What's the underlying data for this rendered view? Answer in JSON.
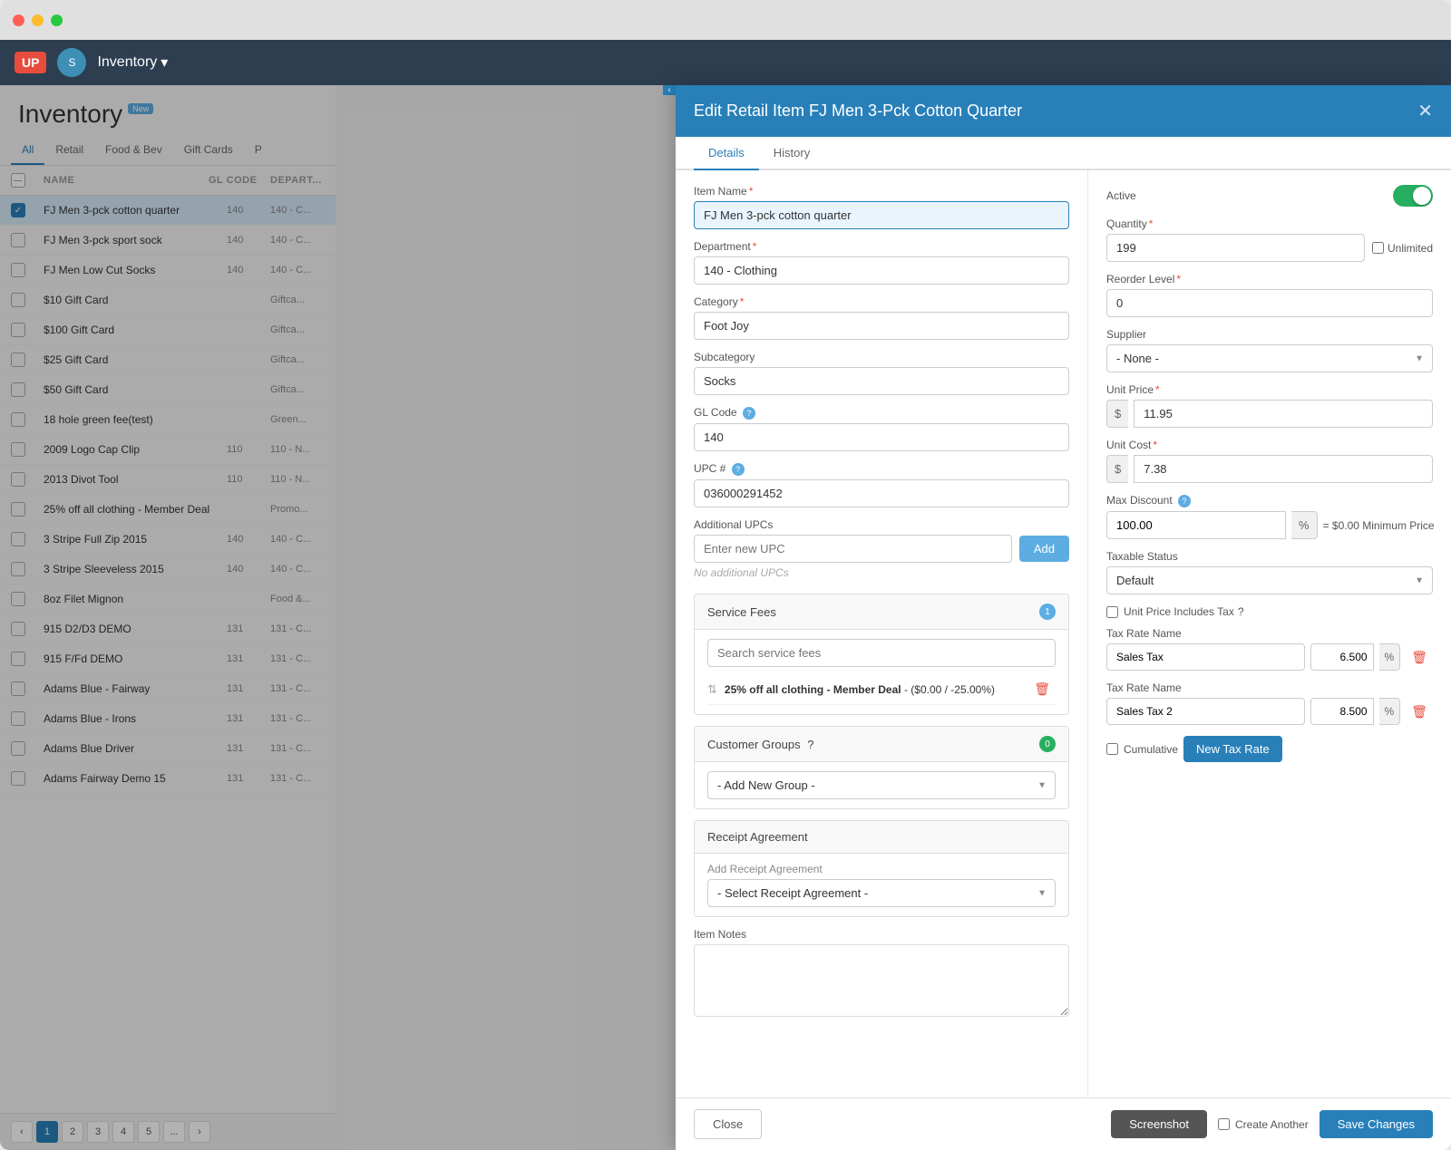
{
  "app": {
    "title": "Inventory",
    "title_badge": "New",
    "nav": {
      "logo_up": "UP",
      "logo_icon": "S",
      "title": "Inventory",
      "caret": "▾"
    }
  },
  "filter_tabs": [
    {
      "label": "All",
      "active": true
    },
    {
      "label": "Retail",
      "active": false
    },
    {
      "label": "Food & Bev",
      "active": false
    },
    {
      "label": "Gift Cards",
      "active": false
    },
    {
      "label": "P",
      "active": false
    }
  ],
  "table_headers": {
    "name": "NAME",
    "gl": "GL CODE",
    "dept": "DEPART..."
  },
  "inventory_items": [
    {
      "selected": true,
      "name": "FJ Men 3-pck cotton quarter",
      "gl": "140",
      "dept": "140 - C..."
    },
    {
      "selected": false,
      "name": "FJ Men 3-pck sport sock",
      "gl": "140",
      "dept": "140 - C..."
    },
    {
      "selected": false,
      "name": "FJ Men Low Cut Socks",
      "gl": "140",
      "dept": "140 - C..."
    },
    {
      "selected": false,
      "name": "$10 Gift Card",
      "gl": "",
      "dept": "Giftca..."
    },
    {
      "selected": false,
      "name": "$100 Gift Card",
      "gl": "",
      "dept": "Giftca..."
    },
    {
      "selected": false,
      "name": "$25 Gift Card",
      "gl": "",
      "dept": "Giftca..."
    },
    {
      "selected": false,
      "name": "$50 Gift Card",
      "gl": "",
      "dept": "Giftca..."
    },
    {
      "selected": false,
      "name": "18 hole green fee(test)",
      "gl": "",
      "dept": "Green..."
    },
    {
      "selected": false,
      "name": "2009 Logo Cap Clip",
      "gl": "110",
      "dept": "110 - N..."
    },
    {
      "selected": false,
      "name": "2013 Divot Tool",
      "gl": "110",
      "dept": "110 - N..."
    },
    {
      "selected": false,
      "name": "25% off all clothing - Member Deal",
      "gl": "",
      "dept": "Promo..."
    },
    {
      "selected": false,
      "name": "3 Stripe Full Zip 2015",
      "gl": "140",
      "dept": "140 - C..."
    },
    {
      "selected": false,
      "name": "3 Stripe Sleeveless 2015",
      "gl": "140",
      "dept": "140 - C..."
    },
    {
      "selected": false,
      "name": "8oz Filet Mignon",
      "gl": "",
      "dept": "Food &..."
    },
    {
      "selected": false,
      "name": "915 D2/D3 DEMO",
      "gl": "131",
      "dept": "131 - C..."
    },
    {
      "selected": false,
      "name": "915 F/Fd DEMO",
      "gl": "131",
      "dept": "131 - C..."
    },
    {
      "selected": false,
      "name": "Adams Blue - Fairway",
      "gl": "131",
      "dept": "131 - C..."
    },
    {
      "selected": false,
      "name": "Adams Blue - Irons",
      "gl": "131",
      "dept": "131 - C..."
    },
    {
      "selected": false,
      "name": "Adams Blue Driver",
      "gl": "131",
      "dept": "131 - C..."
    },
    {
      "selected": false,
      "name": "Adams Fairway Demo 15",
      "gl": "131",
      "dept": "131 - C..."
    }
  ],
  "pagination": {
    "current": 1,
    "pages": [
      "1",
      "2",
      "3",
      "4",
      "5",
      "..."
    ]
  },
  "modal": {
    "title": "Edit Retail Item FJ Men 3-Pck Cotton Quarter",
    "tabs": [
      {
        "label": "Details",
        "active": true
      },
      {
        "label": "History",
        "active": false
      }
    ],
    "left": {
      "item_name_label": "Item Name",
      "item_name_value": "FJ Men 3-pck cotton quarter",
      "department_label": "Department",
      "department_value": "140 - Clothing",
      "category_label": "Category",
      "category_value": "Foot Joy",
      "subcategory_label": "Subcategory",
      "subcategory_value": "Socks",
      "gl_code_label": "GL Code",
      "gl_code_value": "140",
      "upc_label": "UPC #",
      "upc_value": "036000291452",
      "additional_upcs_label": "Additional UPCs",
      "add_upc_placeholder": "Enter new UPC",
      "add_button_label": "Add",
      "no_upcs_text": "No additional UPCs",
      "service_fees_label": "Service Fees",
      "service_fees_count": "1",
      "service_fees_search_placeholder": "Search service fees",
      "service_fees_items": [
        {
          "name": "25% off all clothing - Member Deal",
          "detail": "($0.00 / -25.00%)"
        }
      ],
      "customer_groups_label": "Customer Groups",
      "customer_groups_count": "0",
      "add_group_placeholder": "- Add New Group -",
      "receipt_agreement_label": "Receipt Agreement",
      "add_receipt_label": "Add Receipt Agreement",
      "receipt_select_placeholder": "- Select Receipt Agreement -",
      "item_notes_label": "Item Notes",
      "item_notes_placeholder": ""
    },
    "right": {
      "active_label": "Active",
      "active_value": true,
      "quantity_label": "Quantity",
      "quantity_value": "199",
      "unlimited_label": "Unlimited",
      "unlimited_checked": false,
      "reorder_level_label": "Reorder Level",
      "reorder_level_value": "0",
      "supplier_label": "Supplier",
      "supplier_value": "- None -",
      "unit_price_label": "Unit Price",
      "unit_price_symbol": "$",
      "unit_price_value": "11.95",
      "unit_cost_label": "Unit Cost",
      "unit_cost_symbol": "$",
      "unit_cost_value": "7.38",
      "max_discount_label": "Max Discount",
      "max_discount_value": "100.00",
      "max_discount_symbol": "%",
      "min_price_text": "= $0.00 Minimum Price",
      "taxable_status_label": "Taxable Status",
      "taxable_status_value": "Default",
      "unit_price_includes_tax_label": "Unit Price Includes Tax",
      "tax_rates": [
        {
          "name_label": "Tax Rate Name",
          "name_value": "Sales Tax",
          "pct_value": "6.500",
          "pct_symbol": "%"
        },
        {
          "name_label": "Tax Rate Name",
          "name_value": "Sales Tax 2",
          "pct_value": "8.500",
          "pct_symbol": "%"
        }
      ],
      "cumulative_label": "Cumulative",
      "new_tax_rate_label": "New Tax Rate"
    },
    "footer": {
      "close_label": "Close",
      "screenshot_label": "Screenshot",
      "create_another_label": "Create Another",
      "save_label": "Save Changes"
    }
  }
}
